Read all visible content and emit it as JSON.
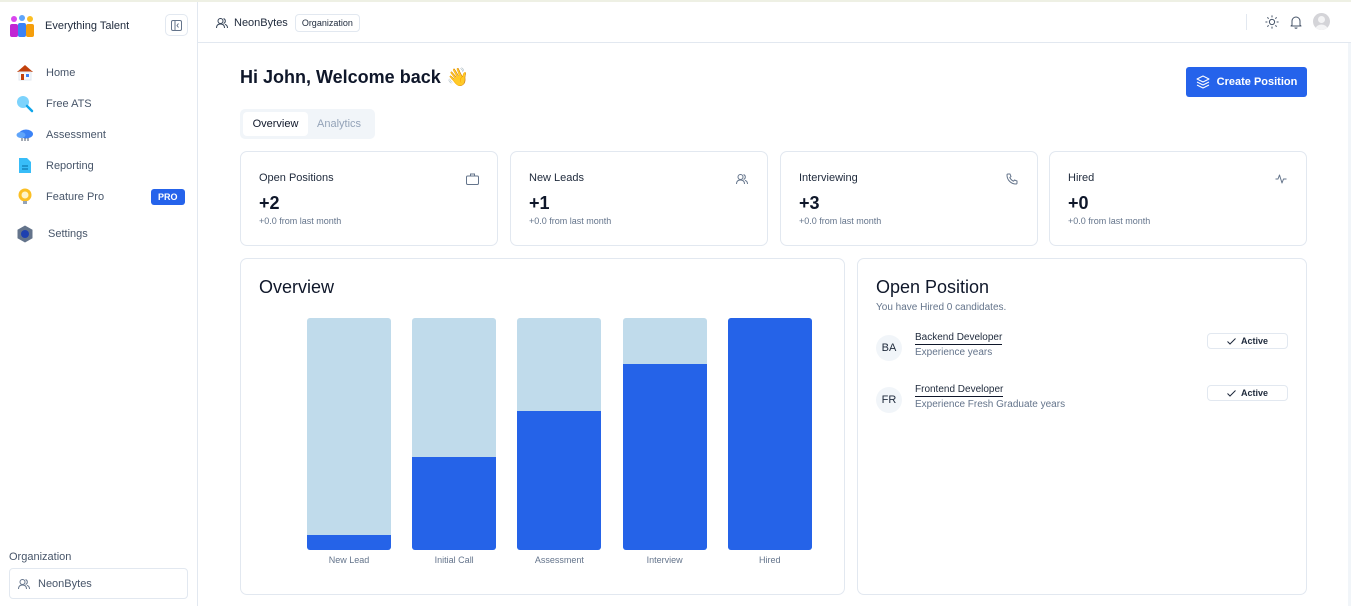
{
  "app": {
    "name": "Everything Talent"
  },
  "sidebar": {
    "items": [
      {
        "label": "Home",
        "icon": "house-icon"
      },
      {
        "label": "Free ATS",
        "icon": "magnifier-icon"
      },
      {
        "label": "Assessment",
        "icon": "cloud-icon"
      },
      {
        "label": "Reporting",
        "icon": "document-icon"
      },
      {
        "label": "Feature Pro",
        "icon": "lightbulb-icon",
        "badge": "PRO"
      },
      {
        "label": "Settings",
        "icon": "gear-icon"
      }
    ],
    "org_label": "Organization",
    "org_value": "NeonBytes"
  },
  "header": {
    "org_name": "NeonBytes",
    "org_tag": "Organization"
  },
  "main": {
    "greeting": "Hi John, Welcome back",
    "greeting_emoji": "👋",
    "create_button": "Create Position",
    "tabs": [
      {
        "label": "Overview",
        "active": true
      },
      {
        "label": "Analytics",
        "active": false
      }
    ],
    "stats": [
      {
        "title": "Open Positions",
        "value": "+2",
        "sub": "+0.0 from last month",
        "icon": "briefcase-icon"
      },
      {
        "title": "New Leads",
        "value": "+1",
        "sub": "+0.0 from last month",
        "icon": "users-icon"
      },
      {
        "title": "Interviewing",
        "value": "+3",
        "sub": "+0.0 from last month",
        "icon": "phone-icon"
      },
      {
        "title": "Hired",
        "value": "+0",
        "sub": "+0.0 from last month",
        "icon": "activity-icon"
      }
    ],
    "overview_title": "Overview",
    "open_position": {
      "title": "Open Position",
      "subtitle": "You have Hired 0 candidates.",
      "items": [
        {
          "initials": "BA",
          "name": "Backend Developer",
          "experience": "Experience years",
          "status": "Active"
        },
        {
          "initials": "FR",
          "name": "Frontend Developer",
          "experience": "Experience Fresh Graduate years",
          "status": "Active"
        }
      ]
    }
  },
  "colors": {
    "accent": "#2563eb",
    "bar_fill": "#2563e8",
    "bar_track": "#c0dbeb"
  },
  "chart_data": {
    "type": "bar",
    "title": "Overview",
    "categories": [
      "New Lead",
      "Initial Call",
      "Assessment",
      "Interview",
      "Hired"
    ],
    "series": [
      {
        "name": "progress",
        "values": [
          6.5,
          40,
          60,
          80,
          100
        ]
      },
      {
        "name": "track",
        "values": [
          100,
          100,
          100,
          100,
          100
        ]
      }
    ],
    "xlabel": "",
    "ylabel": "",
    "ylim": [
      0,
      100
    ],
    "grid": false,
    "legend": "none"
  }
}
